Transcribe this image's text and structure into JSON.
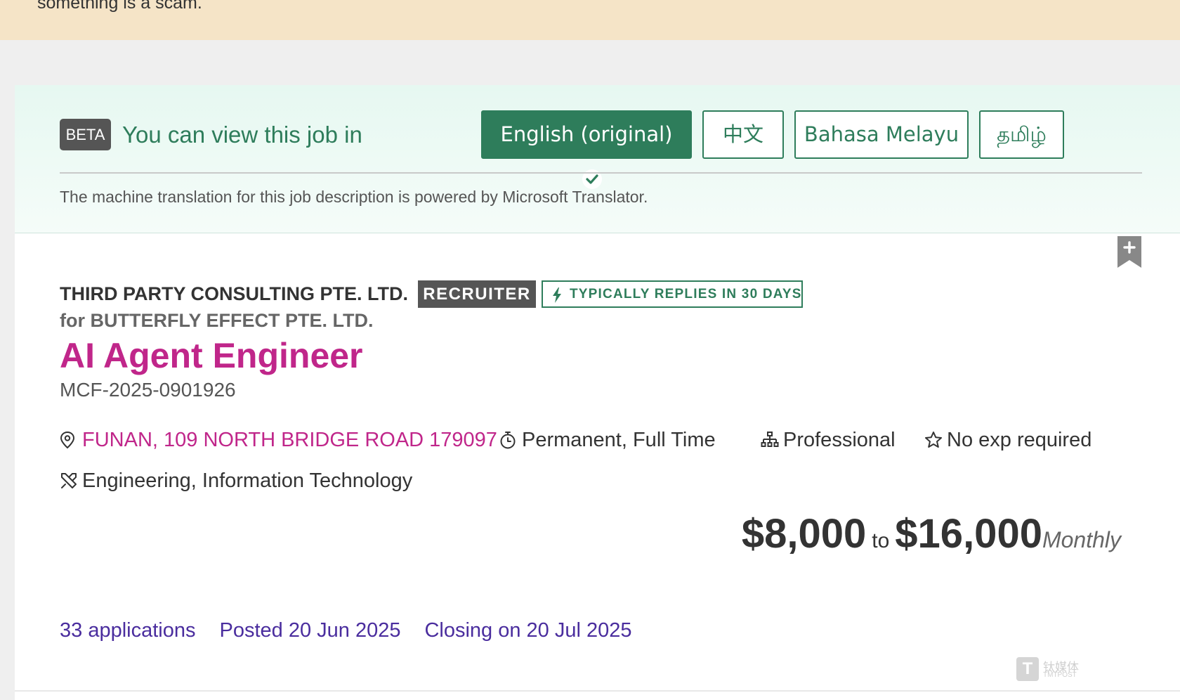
{
  "banner": {
    "text": "something is a scam."
  },
  "translation": {
    "beta_label": "BETA",
    "prompt": "You can view this job in",
    "languages": [
      {
        "label": "English (original)",
        "active": true
      },
      {
        "label": "中文",
        "active": false
      },
      {
        "label": "Bahasa Melayu",
        "active": false
      },
      {
        "label": "தமிழ்",
        "active": false
      }
    ],
    "powered_by": "The machine translation for this job description is powered by Microsoft Translator."
  },
  "job": {
    "company": "THIRD PARTY CONSULTING PTE. LTD.",
    "recruiter_tag": "RECRUITER",
    "replies_tag": "TYPICALLY REPLIES IN 30 DAYS",
    "for_company": "for BUTTERFLY EFFECT PTE. LTD.",
    "title": "AI Agent Engineer",
    "job_id": "MCF-2025-0901926",
    "location": "FUNAN, 109 NORTH BRIDGE ROAD 179097",
    "employment_type": "Permanent, Full Time",
    "seniority": "Professional",
    "experience": "No exp required",
    "category": "Engineering, Information Technology",
    "salary": {
      "min": "$8,000",
      "to": "to",
      "max": "$16,000",
      "period": "Monthly"
    },
    "stats": {
      "applications": "33 applications",
      "posted": "Posted 20 Jun 2025",
      "closing": "Closing on 20 Jul 2025"
    }
  },
  "watermark": {
    "cn": "钛媒体",
    "en": "TMTPOST",
    "mark": "T"
  },
  "colors": {
    "brand_green": "#2e7d5b",
    "title_magenta": "#c0268a",
    "stats_purple": "#4a2d9e",
    "banner_bg": "#f5e4c7"
  }
}
